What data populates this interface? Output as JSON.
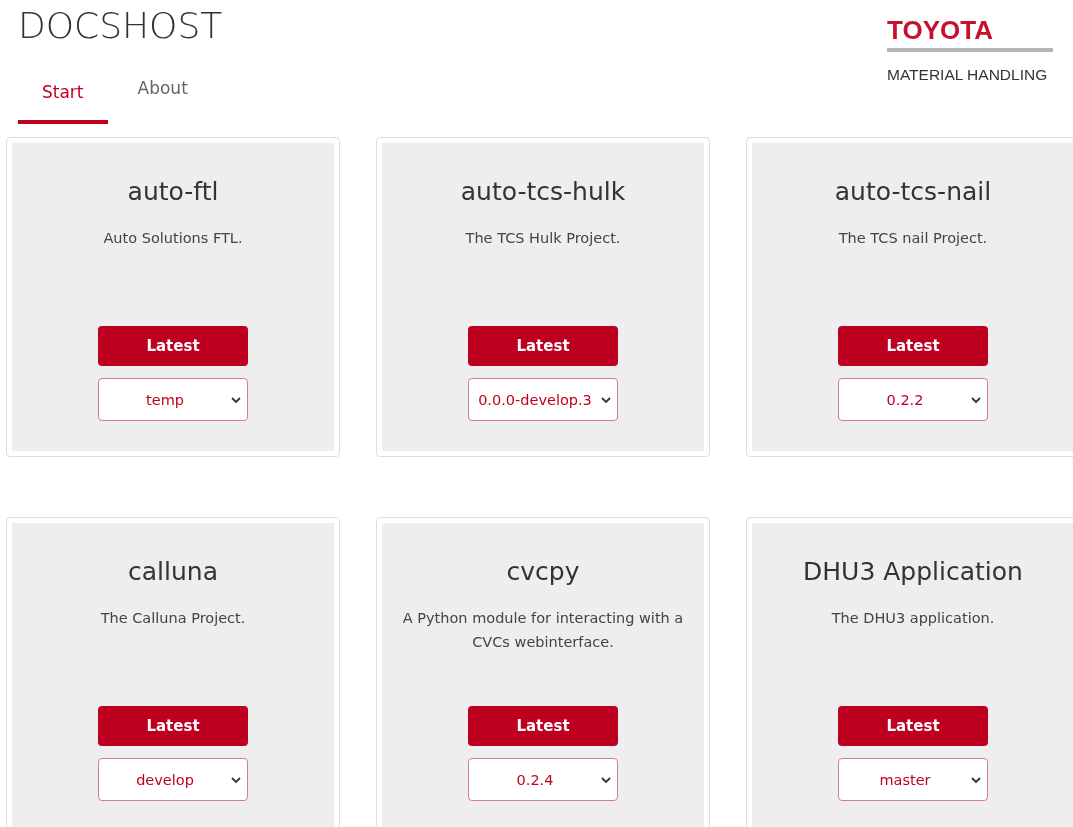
{
  "title": "DOCSHOST",
  "logo": {
    "brand": "TOYOTA",
    "subtitle": "MATERIAL HANDLING"
  },
  "tabs": [
    {
      "label": "Start",
      "selected": true
    },
    {
      "label": "About",
      "selected": false
    }
  ],
  "projects": [
    {
      "name": "auto-ftl",
      "description": "Auto Solutions FTL.",
      "button": "Latest",
      "version": "temp"
    },
    {
      "name": "auto-tcs-hulk",
      "description": "The TCS Hulk Project.",
      "button": "Latest",
      "version": "0.0.0-develop.3"
    },
    {
      "name": "auto-tcs-nail",
      "description": "The TCS nail Project.",
      "button": "Latest",
      "version": "0.2.2"
    },
    {
      "name": "calluna",
      "description": "The Calluna Project.",
      "button": "Latest",
      "version": "develop"
    },
    {
      "name": "cvcpy",
      "description": "A Python module for interacting with a CVCs webinterface.",
      "button": "Latest",
      "version": "0.2.4"
    },
    {
      "name": "DHU3 Application",
      "description": "The DHU3 application.",
      "button": "Latest",
      "version": "master"
    }
  ]
}
